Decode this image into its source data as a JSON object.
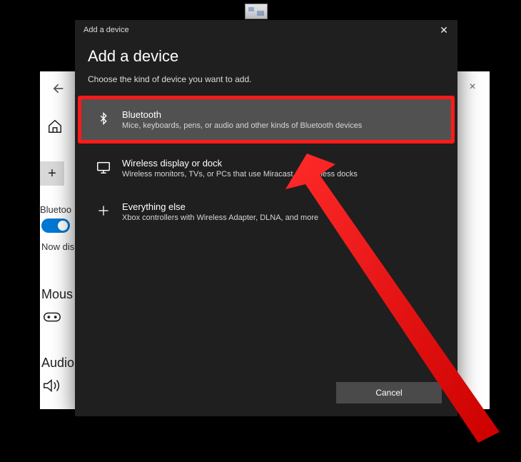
{
  "background": {
    "bluetooth_label": "Bluetoo",
    "now_label": "Now dis",
    "mouse_label": "Mous",
    "audio_label": "Audio",
    "add_symbol": "+",
    "close_symbol": "×"
  },
  "dialog": {
    "window_title": "Add a device",
    "heading": "Add a device",
    "subhead": "Choose the kind of device you want to add.",
    "options": [
      {
        "title": "Bluetooth",
        "desc": "Mice, keyboards, pens, or audio and other kinds of Bluetooth devices"
      },
      {
        "title": "Wireless display or dock",
        "desc": "Wireless monitors, TVs, or PCs that use Miracast, or wireless docks"
      },
      {
        "title": "Everything else",
        "desc": "Xbox controllers with Wireless Adapter, DLNA, and more"
      }
    ],
    "cancel": "Cancel",
    "close_symbol": "✕"
  }
}
